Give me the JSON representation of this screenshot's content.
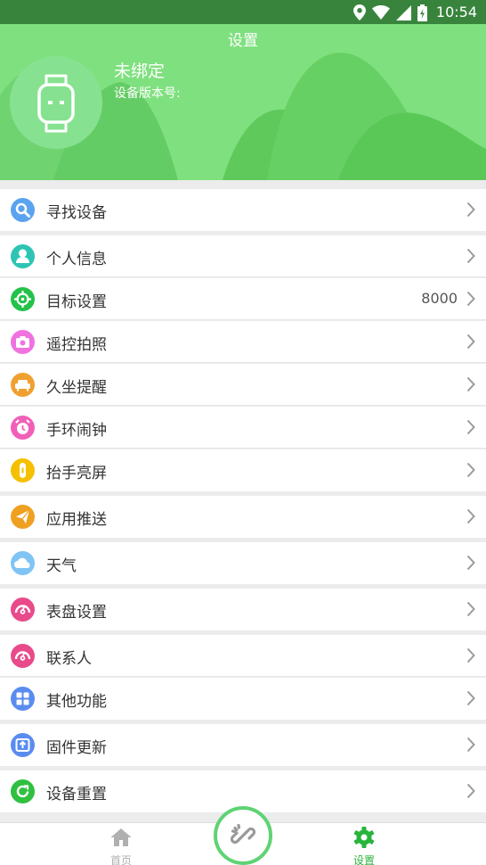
{
  "status_bar": {
    "time": "10:54"
  },
  "header": {
    "title": "设置",
    "device_name": "未绑定",
    "device_version_label": "设备版本号:"
  },
  "menu": [
    {
      "label": "寻找设备",
      "value": "",
      "icon": "search-icon",
      "color": "#5aa3f0"
    },
    {
      "label": "个人信息",
      "value": "",
      "icon": "person-icon",
      "color": "#2ec4b4"
    },
    {
      "label": "目标设置",
      "value": "8000",
      "icon": "target-icon",
      "color": "#24c24a"
    },
    {
      "label": "遥控拍照",
      "value": "",
      "icon": "camera-icon",
      "color": "#f072e0"
    },
    {
      "label": "久坐提醒",
      "value": "",
      "icon": "sofa-icon",
      "color": "#f0a030"
    },
    {
      "label": "手环闹钟",
      "value": "",
      "icon": "alarm-clock-icon",
      "color": "#f060b8"
    },
    {
      "label": "抬手亮屏",
      "value": "",
      "icon": "band-icon",
      "color": "#f5c000"
    },
    {
      "label": "应用推送",
      "value": "",
      "icon": "send-icon",
      "color": "#f0a020"
    },
    {
      "label": "天气",
      "value": "",
      "icon": "cloud-icon",
      "color": "#80c4f4"
    },
    {
      "label": "表盘设置",
      "value": "",
      "icon": "dial-icon",
      "color": "#e84a8a"
    },
    {
      "label": "联系人",
      "value": "",
      "icon": "contact-icon",
      "color": "#e84a8a"
    },
    {
      "label": "其他功能",
      "value": "",
      "icon": "grid-icon",
      "color": "#5a8cf0"
    },
    {
      "label": "固件更新",
      "value": "",
      "icon": "firmware-icon",
      "color": "#5a8cf0"
    },
    {
      "label": "设备重置",
      "value": "",
      "icon": "refresh-icon",
      "color": "#30c040"
    }
  ],
  "bottom_nav": {
    "home_label": "首页",
    "settings_label": "设置",
    "active_color": "#29b43c",
    "inactive_color": "#b0b0b0"
  }
}
